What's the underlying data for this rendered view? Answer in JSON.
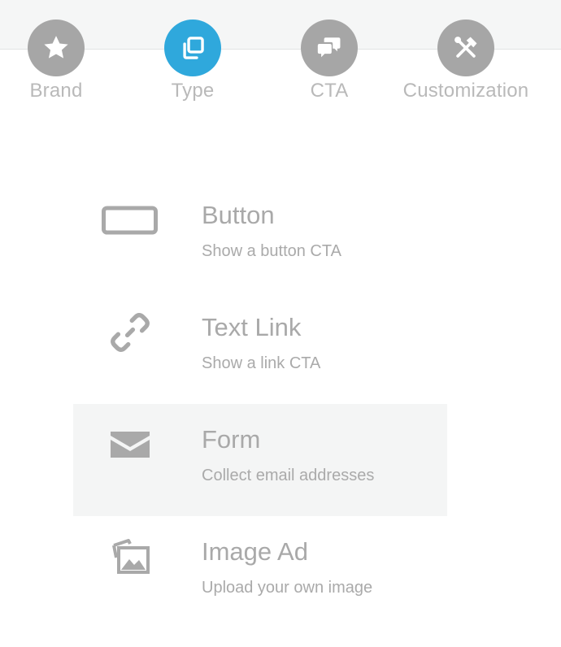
{
  "wizard": {
    "steps": [
      {
        "label": "Brand",
        "icon": "star-icon",
        "state": "inactive"
      },
      {
        "label": "Type",
        "icon": "copy-icon",
        "state": "active"
      },
      {
        "label": "CTA",
        "icon": "chat-bubbles-icon",
        "state": "inactive"
      },
      {
        "label": "Customization",
        "icon": "tools-icon",
        "state": "inactive"
      }
    ]
  },
  "options": [
    {
      "title": "Button",
      "description": "Show a button CTA",
      "icon": "button-icon",
      "selected": false
    },
    {
      "title": "Text Link",
      "description": "Show a link CTA",
      "icon": "link-icon",
      "selected": false
    },
    {
      "title": "Form",
      "description": "Collect email addresses",
      "icon": "envelope-icon",
      "selected": true
    },
    {
      "title": "Image Ad",
      "description": "Upload your own image",
      "icon": "image-icon",
      "selected": false
    }
  ],
  "colors": {
    "accent": "#2fa8dc",
    "inactive_step": "#a6a6a6",
    "text": "#a9a9a9",
    "highlight_bg": "#f4f5f5",
    "topbar_bg": "#f5f6f6"
  }
}
